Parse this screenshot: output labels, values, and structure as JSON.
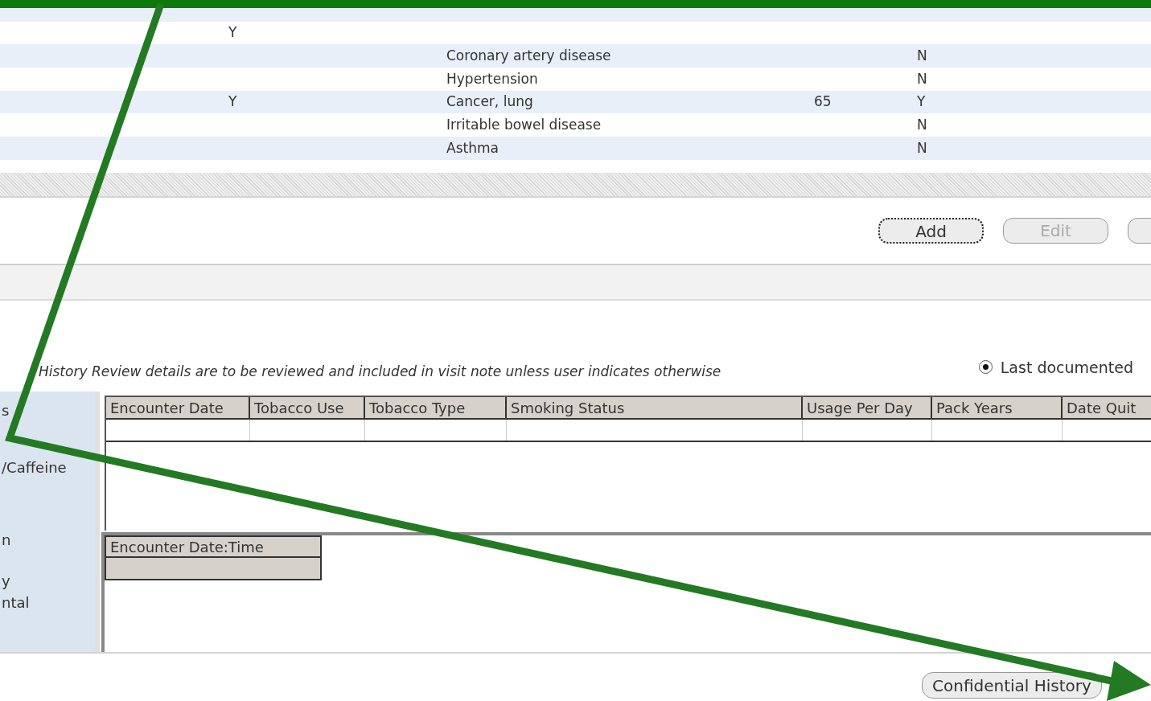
{
  "history_table": {
    "rows": [
      {
        "column_1": "Y"
      },
      {
        "condition": "Coronary artery disease",
        "column_4": "N"
      },
      {
        "condition": "Hypertension",
        "column_4": "N"
      },
      {
        "column_1": "Y",
        "condition": "Cancer, lung",
        "column_3": "65",
        "column_4": "Y"
      },
      {
        "condition": "Irritable bowel disease",
        "column_4": "N"
      },
      {
        "condition": "Asthma",
        "column_4": "N"
      }
    ]
  },
  "actions": [
    {
      "label": "Add",
      "focused": true,
      "disabled": false
    },
    {
      "label": "Edit",
      "focused": false,
      "disabled": true
    },
    {
      "focused": false
    }
  ],
  "note": "History Review details are to be reviewed and included in visit note unless user indicates otherwise",
  "view_options": [
    {
      "label": "Last documented",
      "selected": true
    }
  ],
  "sidebar": {
    "items": [
      "s",
      "/Caffeine",
      "n",
      "y",
      "ntal"
    ]
  },
  "smoking_table": {
    "columns": [
      "Encounter Date",
      "Tobacco Use",
      "Tobacco Type",
      "Smoking Status",
      "Usage Per Day",
      "Pack Years",
      "Date Quit"
    ]
  },
  "encounter_table": {
    "columns": [
      "Encounter Date:Time"
    ]
  },
  "footer_buttons": [
    {
      "label": "Confidential History"
    }
  ]
}
